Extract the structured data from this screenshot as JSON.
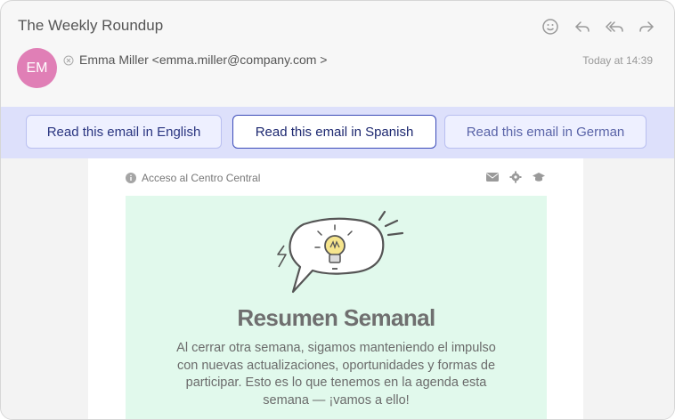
{
  "email": {
    "subject": "The Weekly Roundup",
    "sender": "Emma Miller <emma.miller@company.com >",
    "avatar_initials": "EM",
    "timestamp": "Today at 14:39",
    "action_icons": [
      "smiley-icon",
      "reply-icon",
      "reply-all-icon",
      "forward-icon"
    ]
  },
  "language_bar": {
    "english_label": "Read this email in English",
    "spanish_label": "Read this email in Spanish",
    "german_label": "Read this email in German",
    "selected": "Spanish"
  },
  "content": {
    "top_link": "Acceso al Centro Central",
    "top_icons": [
      "mail-icon",
      "gear-icon",
      "graduation-cap-icon"
    ],
    "heading": "Resumen Semanal",
    "paragraph": "Al cerrar otra semana, sigamos manteniendo el impulso con nuevas actualizaciones, oportunidades y formas de participar. Esto es lo que tenemos en la agenda esta semana — ¡vamos a ello!"
  },
  "colors": {
    "avatar": "#e07fb6",
    "language_bar": "#dde0fb",
    "hero_background": "#e1f9ec",
    "active_border": "#3b4bb8"
  }
}
